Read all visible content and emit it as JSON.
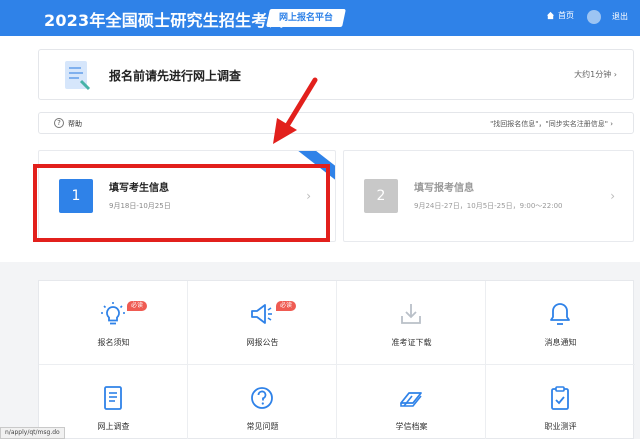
{
  "header": {
    "title": "2023年全国硕士研究生招生考试",
    "platform_tag": "网上报名平台",
    "home_label": "首页",
    "logout_label": "退出",
    "brand_color": "#2f82e8"
  },
  "survey": {
    "title": "报名前请先进行网上调查",
    "time_hint": "大约1分钟",
    "chevron": "›"
  },
  "help": {
    "label": "帮助",
    "links": "\"找回报名信息\"，\"同步实名注册信息\"",
    "chevron": "›"
  },
  "steps": [
    {
      "number": "1",
      "title": "填写考生信息",
      "date": "9月18日-10月25日",
      "state": "active",
      "chevron": "›"
    },
    {
      "number": "2",
      "title": "填写报考信息",
      "date": "9月24日-27日，10月5日-25日，9:00～22:00",
      "state": "disabled",
      "chevron": "›"
    }
  ],
  "annotation": {
    "highlight_color": "#e2201c"
  },
  "grid": [
    {
      "label": "报名须知",
      "icon": "lightbulb-icon",
      "badge": "必读"
    },
    {
      "label": "网报公告",
      "icon": "megaphone-icon",
      "badge": "必读"
    },
    {
      "label": "准考证下载",
      "icon": "download-tray-icon",
      "badge": ""
    },
    {
      "label": "消息通知",
      "icon": "bell-icon",
      "badge": ""
    },
    {
      "label": "网上调查",
      "icon": "survey-document-icon",
      "badge": ""
    },
    {
      "label": "常见问题",
      "icon": "question-circle-icon",
      "badge": ""
    },
    {
      "label": "学信档案",
      "icon": "archive-icon",
      "badge": ""
    },
    {
      "label": "职业测评",
      "icon": "clipboard-check-icon",
      "badge": ""
    }
  ],
  "statusbar": {
    "url": "n/apply/qt/msg.do"
  }
}
